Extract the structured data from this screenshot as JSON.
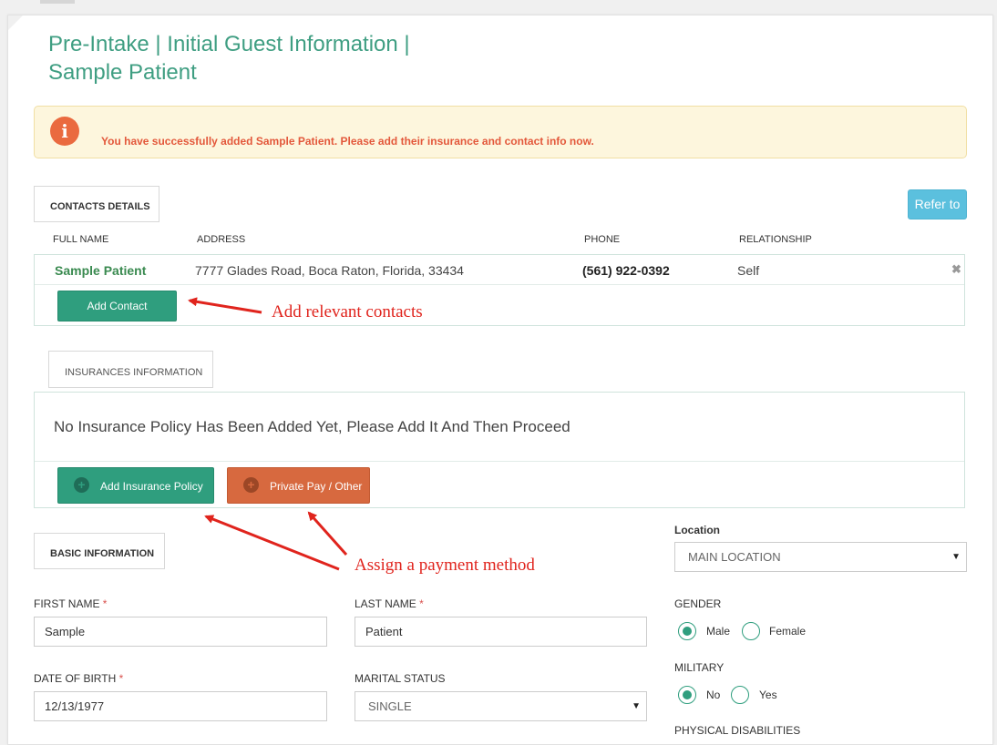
{
  "page": {
    "title_line1": "Pre-Intake | Initial Guest Information |",
    "title_line2": "Sample Patient"
  },
  "alert": {
    "icon": "info-icon",
    "message": "You have successfully added Sample Patient. Please add their insurance and contact info now."
  },
  "contacts": {
    "tab_label": "CONTACTS DETAILS",
    "refer_button": "Refer to",
    "columns": [
      "FULL NAME",
      "ADDRESS",
      "PHONE",
      "RELATIONSHIP"
    ],
    "rows": [
      {
        "full_name": "Sample Patient",
        "address": "7777 Glades Road, Boca Raton, Florida, 33434",
        "phone": "(561) 922-0392",
        "relationship": "Self",
        "remove_icon": "close-icon"
      }
    ],
    "add_button": "Add Contact"
  },
  "insurance": {
    "tab_label": "INSURANCES INFORMATION",
    "empty_message": "No Insurance Policy Has Been Added Yet, Please Add It And Then Proceed",
    "add_policy_button": "Add Insurance Policy",
    "private_pay_button": "Private Pay / Other"
  },
  "annotations": {
    "contacts": "Add relevant contacts",
    "payment": "Assign a payment method",
    "color": "#e0241d"
  },
  "basic_info": {
    "tab_label": "BASIC INFORMATION",
    "first_name_label": "FIRST NAME",
    "first_name_value": "Sample",
    "last_name_label": "LAST NAME",
    "last_name_value": "Patient",
    "dob_label": "DATE OF BIRTH",
    "dob_value": "12/13/1977",
    "marital_label": "MARITAL STATUS",
    "marital_value": "SINGLE",
    "required_mark": "*",
    "location_label": "Location",
    "location_value": "MAIN LOCATION",
    "gender_label": "GENDER",
    "gender_options": [
      "Male",
      "Female"
    ],
    "gender_selected": "Male",
    "military_label": "MILITARY",
    "military_options": [
      "No",
      "Yes"
    ],
    "military_selected": "No",
    "physical_disabilities_label": "PHYSICAL DISABILITIES"
  },
  "colors": {
    "accent_green": "#2f9e7e",
    "title_green": "#3f9e82",
    "private_pay_orange": "#d7693f",
    "refer_blue": "#5bc0de",
    "alert_bg": "#fdf6dd",
    "alert_text": "#e3583b"
  }
}
